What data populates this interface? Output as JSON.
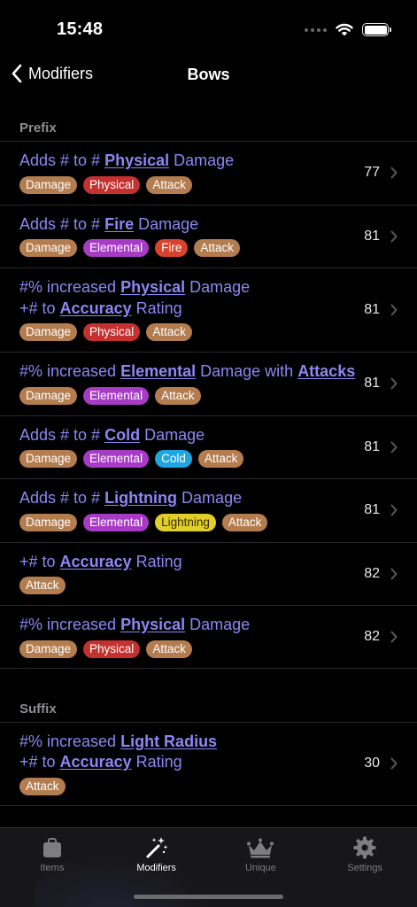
{
  "status_bar": {
    "time": "15:48",
    "battery_level": 1.0
  },
  "nav": {
    "back_label": "Modifiers",
    "title": "Bows"
  },
  "colors": {
    "Damage": "#b37d50",
    "Physical": "#c4312f",
    "Attack": "#b37d50",
    "Elemental": "#a83bc6",
    "Fire": "#d8432c",
    "Cold": "#1fa6e0",
    "Lightning": "#e0cf2b"
  },
  "sections": [
    {
      "header": "Prefix",
      "rows": [
        {
          "title": [
            [
              "Adds # to # ",
              false
            ],
            [
              "Physical",
              true
            ],
            [
              " Damage",
              false
            ]
          ],
          "tags": [
            "Damage",
            "Physical",
            "Attack"
          ],
          "value": "77"
        },
        {
          "title": [
            [
              "Adds # to # ",
              false
            ],
            [
              "Fire",
              true
            ],
            [
              " Damage",
              false
            ]
          ],
          "tags": [
            "Damage",
            "Elemental",
            "Fire",
            "Attack"
          ],
          "value": "81"
        },
        {
          "title": [
            [
              "#% increased ",
              false
            ],
            [
              "Physical",
              true
            ],
            [
              " Damage",
              false
            ],
            [
              "\n+# to ",
              false
            ],
            [
              "Accuracy",
              true
            ],
            [
              " Rating",
              false
            ]
          ],
          "tags": [
            "Damage",
            "Physical",
            "Attack"
          ],
          "value": "81"
        },
        {
          "title": [
            [
              "#% increased ",
              false
            ],
            [
              "Elemental",
              true
            ],
            [
              " Damage with ",
              false
            ],
            [
              "Attacks",
              true
            ]
          ],
          "tags": [
            "Damage",
            "Elemental",
            "Attack"
          ],
          "value": "81"
        },
        {
          "title": [
            [
              "Adds # to # ",
              false
            ],
            [
              "Cold",
              true
            ],
            [
              " Damage",
              false
            ]
          ],
          "tags": [
            "Damage",
            "Elemental",
            "Cold",
            "Attack"
          ],
          "value": "81"
        },
        {
          "title": [
            [
              "Adds # to # ",
              false
            ],
            [
              "Lightning",
              true
            ],
            [
              " Damage",
              false
            ]
          ],
          "tags": [
            "Damage",
            "Elemental",
            "Lightning",
            "Attack"
          ],
          "value": "81"
        },
        {
          "title": [
            [
              "+# to ",
              false
            ],
            [
              "Accuracy",
              true
            ],
            [
              " Rating",
              false
            ]
          ],
          "tags": [
            "Attack"
          ],
          "value": "82"
        },
        {
          "title": [
            [
              "#% increased ",
              false
            ],
            [
              "Physical",
              true
            ],
            [
              " Damage",
              false
            ]
          ],
          "tags": [
            "Damage",
            "Physical",
            "Attack"
          ],
          "value": "82"
        }
      ]
    },
    {
      "header": "Suffix",
      "rows": [
        {
          "title": [
            [
              "#% increased ",
              false
            ],
            [
              "Light Radius",
              true
            ],
            [
              "\n+# to ",
              false
            ],
            [
              "Accuracy",
              true
            ],
            [
              " Rating",
              false
            ]
          ],
          "tags": [
            "Attack"
          ],
          "value": "30"
        }
      ]
    }
  ],
  "tabs": [
    {
      "label": "Items",
      "icon": "bag-icon",
      "active": false
    },
    {
      "label": "Modifiers",
      "icon": "magic-wand-icon",
      "active": true
    },
    {
      "label": "Unique",
      "icon": "crown-icon",
      "active": false
    },
    {
      "label": "Settings",
      "icon": "gear-icon",
      "active": false
    }
  ]
}
